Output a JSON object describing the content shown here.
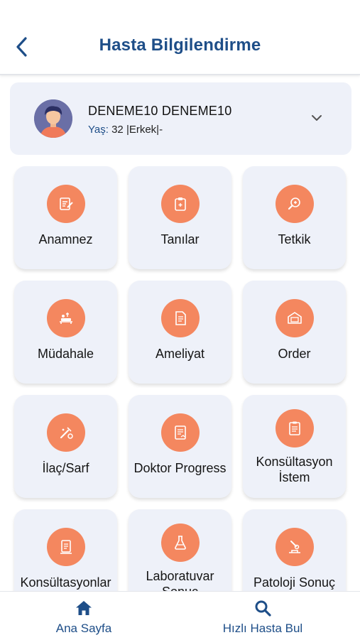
{
  "header": {
    "title": "Hasta Bilgilendirme",
    "back_icon": "chevron-left-icon"
  },
  "patient": {
    "name": "DENEME10 DENEME10",
    "age_label": "Yaş:",
    "age_value": "32",
    "gender": "|Erkek|-",
    "avatar_icon": "avatar",
    "expand_icon": "chevron-down-icon"
  },
  "menu": {
    "items": [
      {
        "label": "Anamnez",
        "icon": "notes-edit-icon"
      },
      {
        "label": "Tanılar",
        "icon": "clipboard-icon"
      },
      {
        "label": "Tetkik",
        "icon": "microscope-icon"
      },
      {
        "label": "Müdahale",
        "icon": "procedure-bed-icon"
      },
      {
        "label": "Ameliyat",
        "icon": "surgery-report-icon"
      },
      {
        "label": "Order",
        "icon": "order-box-icon"
      },
      {
        "label": "İlaç/Sarf",
        "icon": "medication-icon"
      },
      {
        "label": "Doktor Progress",
        "icon": "progress-document-icon"
      },
      {
        "label": "Konsültasyon İstem",
        "icon": "consult-request-icon"
      },
      {
        "label": "Konsültasyonlar",
        "icon": "consultations-icon"
      },
      {
        "label": "Laboratuvar Sonuç",
        "icon": "lab-flask-icon"
      },
      {
        "label": "Patoloji Sonuç",
        "icon": "pathology-icon"
      }
    ]
  },
  "bottom_nav": {
    "home": {
      "label": "Ana Sayfa",
      "icon": "home-icon"
    },
    "search": {
      "label": "Hızlı Hasta Bul",
      "icon": "search-icon"
    }
  },
  "colors": {
    "primary": "#1e4e88",
    "accent": "#f4875f",
    "tile_bg": "#eef1f9"
  }
}
